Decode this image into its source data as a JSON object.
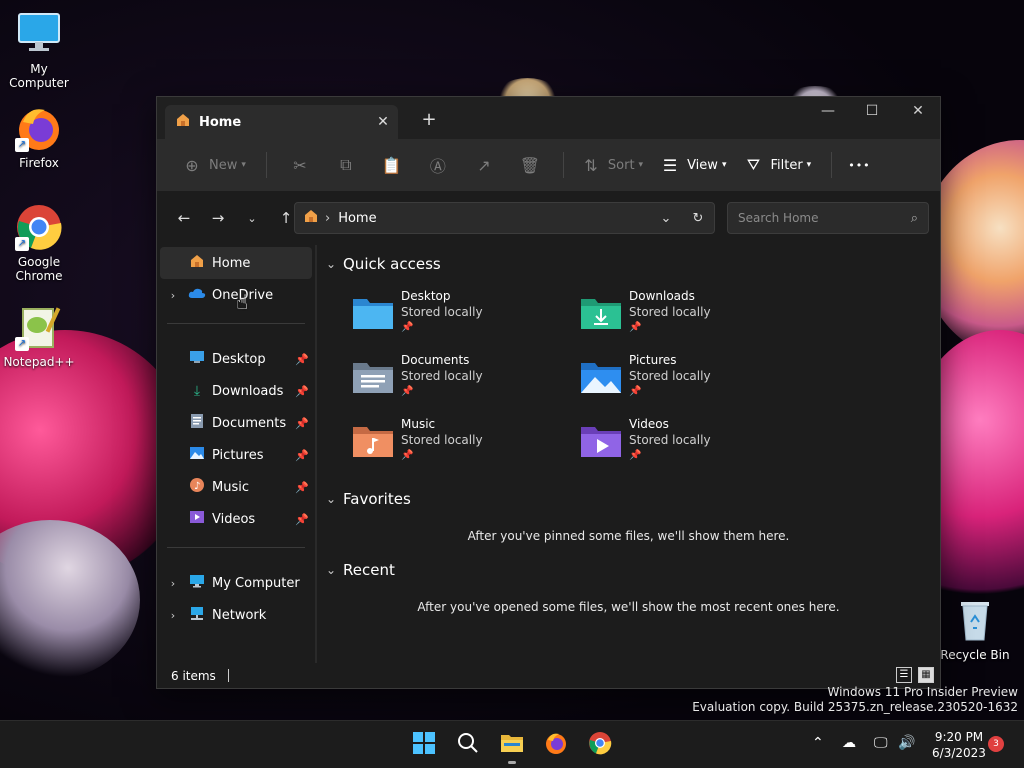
{
  "desktop": {
    "icons": [
      {
        "label": "My Computer"
      },
      {
        "label": "Firefox"
      },
      {
        "label": "Google Chrome"
      },
      {
        "label": "Notepad++"
      },
      {
        "label": "Recycle Bin"
      }
    ]
  },
  "window": {
    "tab_title": "Home",
    "tab_close": "✕",
    "new_tab": "+",
    "controls": {
      "minimize": "—",
      "maximize": "☐",
      "close": "✕"
    }
  },
  "toolbar": {
    "new_label": "New",
    "sort_label": "Sort",
    "view_label": "View",
    "filter_label": "Filter",
    "more_label": "•••"
  },
  "address": {
    "current": "Home",
    "search_placeholder": "Search Home"
  },
  "sidebar": {
    "items": [
      {
        "label": "Home"
      },
      {
        "label": "OneDrive"
      },
      {
        "label": "Desktop"
      },
      {
        "label": "Downloads"
      },
      {
        "label": "Documents"
      },
      {
        "label": "Pictures"
      },
      {
        "label": "Music"
      },
      {
        "label": "Videos"
      },
      {
        "label": "My Computer"
      },
      {
        "label": "Network"
      }
    ]
  },
  "content": {
    "quick_access_title": "Quick access",
    "quick_access": [
      {
        "name": "Desktop",
        "status": "Stored locally"
      },
      {
        "name": "Downloads",
        "status": "Stored locally"
      },
      {
        "name": "Documents",
        "status": "Stored locally"
      },
      {
        "name": "Pictures",
        "status": "Stored locally"
      },
      {
        "name": "Music",
        "status": "Stored locally"
      },
      {
        "name": "Videos",
        "status": "Stored locally"
      }
    ],
    "favorites_title": "Favorites",
    "favorites_empty": "After you've pinned some files, we'll show them here.",
    "recent_title": "Recent",
    "recent_empty": "After you've opened some files, we'll show the most recent ones here."
  },
  "statusbar": {
    "item_count": "6 items"
  },
  "watermark": {
    "line1": "Windows 11 Pro Insider Preview",
    "line2": "Evaluation copy. Build 25375.zn_release.230520-1632"
  },
  "taskbar": {
    "time": "9:20 PM",
    "date": "6/3/2023",
    "notification_count": "3"
  },
  "colors": {
    "accent": "#4cc2ff",
    "folder_blue": "#3aa0e8",
    "folder_green": "#2bb58a",
    "folder_gray": "#7e8fa3",
    "folder_orange": "#e8855a",
    "folder_purple": "#8a5ad8"
  }
}
